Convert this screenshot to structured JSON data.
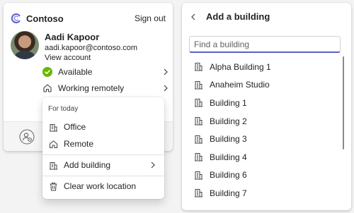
{
  "profile_card": {
    "brand": "Contoso",
    "signout_label": "Sign out",
    "user_name": "Aadi Kapoor",
    "user_email": "aadi.kapoor@contoso.com",
    "view_account_label": "View account",
    "status_label": "Available",
    "status_color": "#6bb700",
    "location_label": "Working remotely"
  },
  "location_menu": {
    "section_label": "For today",
    "items": [
      {
        "label": "Office",
        "icon": "building-icon"
      },
      {
        "label": "Remote",
        "icon": "home-icon"
      },
      {
        "label": "Add building",
        "icon": "building-icon"
      },
      {
        "label": "Clear work location",
        "icon": "trash-icon"
      }
    ]
  },
  "building_panel": {
    "title": "Add a building",
    "search_placeholder": "Find a building",
    "search_value": "",
    "accent_color": "#5b5fc7",
    "buildings": [
      "Alpha Building 1",
      "Anaheim Studio",
      "Building 1",
      "Building 2",
      "Building 3",
      "Building 4",
      "Building 6",
      "Building 7"
    ]
  }
}
